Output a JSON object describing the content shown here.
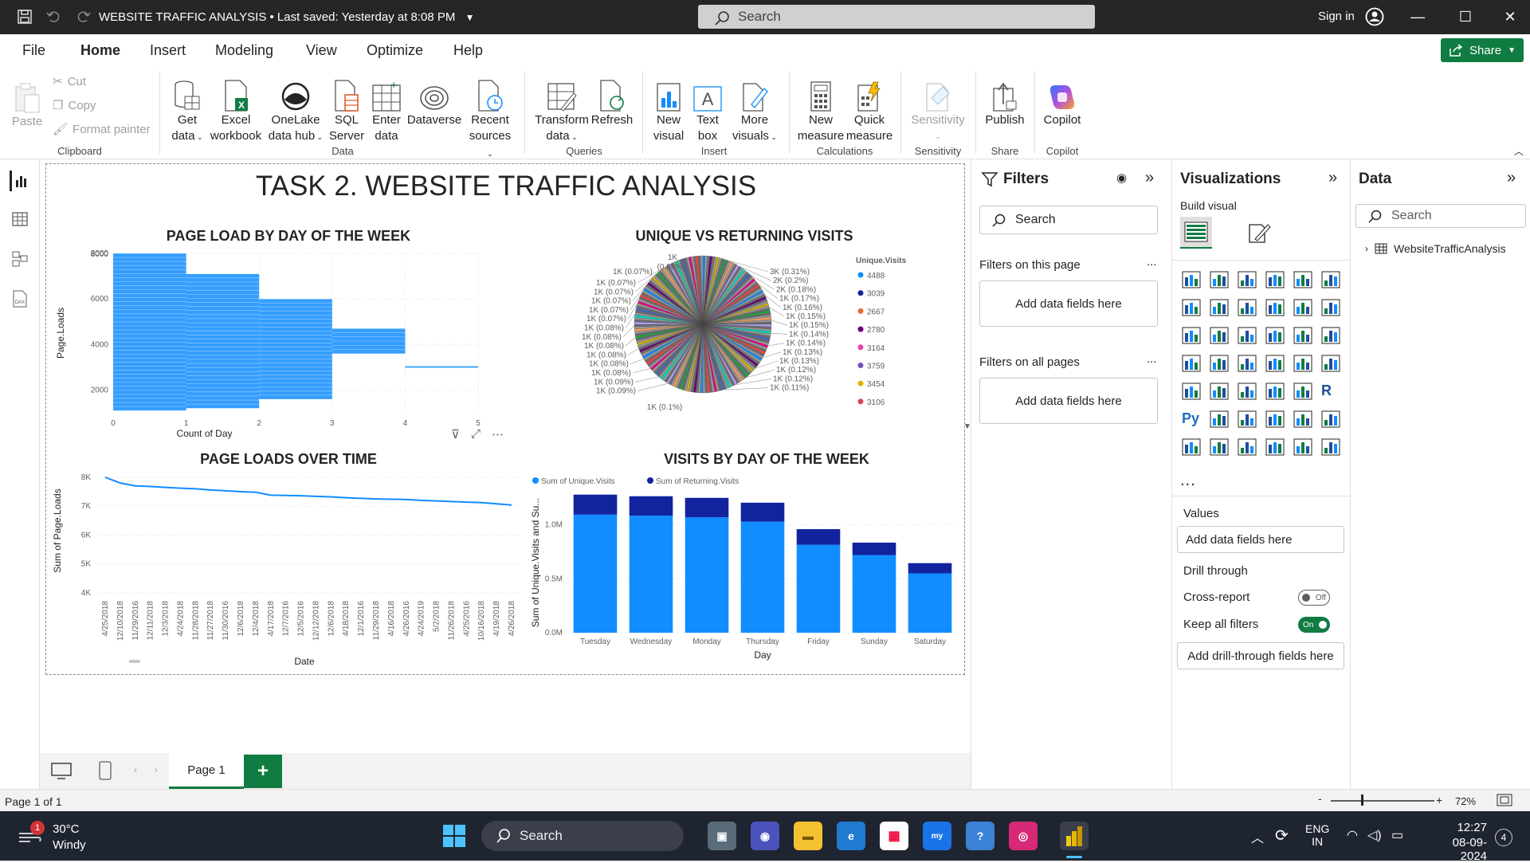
{
  "titlebar": {
    "title": "WEBSITE TRAFFIC ANALYSIS",
    "saved": "• Last saved: Yesterday at 8:08 PM",
    "search": "Search",
    "signin": "Sign in"
  },
  "menu": [
    "File",
    "Home",
    "Insert",
    "Modeling",
    "View",
    "Optimize",
    "Help"
  ],
  "share": "Share",
  "ribbon": {
    "clipboard": {
      "paste": "Paste",
      "cut": "Cut",
      "copy": "Copy",
      "format_painter": "Format painter",
      "group": "Clipboard"
    },
    "data": {
      "get_data": "Get",
      "get_data2": "data",
      "excel": "Excel",
      "excel2": "workbook",
      "onelake": "OneLake",
      "onelake2": "data hub",
      "sql": "SQL",
      "sql2": "Server",
      "enter": "Enter",
      "enter2": "data",
      "dataverse": "Dataverse",
      "recent": "Recent",
      "recent2": "sources",
      "group": "Data"
    },
    "queries": {
      "transform": "Transform",
      "transform2": "data",
      "refresh": "Refresh",
      "group": "Queries"
    },
    "insert": {
      "new_visual": "New",
      "new_visual2": "visual",
      "text_box": "Text",
      "text_box2": "box",
      "more": "More",
      "more2": "visuals",
      "group": "Insert"
    },
    "calculations": {
      "new_measure": "New",
      "new_measure2": "measure",
      "quick": "Quick",
      "quick2": "measure",
      "group": "Calculations"
    },
    "sensitivity": {
      "label": "Sensitivity",
      "group": "Sensitivity"
    },
    "share": {
      "publish": "Publish",
      "group": "Share"
    },
    "copilot": {
      "label": "Copilot",
      "group": "Copilot"
    }
  },
  "report": {
    "title": "TASK 2. WEBSITE TRAFFIC ANALYSIS"
  },
  "chart_data": [
    {
      "type": "bar",
      "title": "PAGE LOAD BY DAY OF THE WEEK",
      "xlabel": "Count of Day",
      "ylabel": "Page.Loads",
      "xlim": [
        0,
        5
      ],
      "xticks": [
        "0",
        "1",
        "2",
        "3",
        "4",
        "5"
      ],
      "ylim": [
        1000,
        8000
      ],
      "yticks": [
        "2000",
        "4000",
        "6000",
        "8000"
      ],
      "bands": [
        {
          "count": 1,
          "ymin": 1100,
          "ymax": 8000
        },
        {
          "count": 2,
          "ymin": 1200,
          "ymax": 7100
        },
        {
          "count": 3,
          "ymin": 1600,
          "ymax": 6000
        },
        {
          "count": 4,
          "ymin": 3600,
          "ymax": 4700
        },
        {
          "count": 5,
          "ymin": 3000,
          "ymax": 3050
        }
      ]
    },
    {
      "type": "pie",
      "title": "UNIQUE VS RETURNING VISITS",
      "legend_title": "Unique.Visits",
      "legend": [
        {
          "name": "4488",
          "color": "#118dff"
        },
        {
          "name": "3039",
          "color": "#12239e"
        },
        {
          "name": "2667",
          "color": "#e66c37"
        },
        {
          "name": "2780",
          "color": "#6b007b"
        },
        {
          "name": "3164",
          "color": "#e044a7"
        },
        {
          "name": "3759",
          "color": "#744ec2"
        },
        {
          "name": "3454",
          "color": "#d9b300"
        },
        {
          "name": "3106",
          "color": "#d64550"
        }
      ],
      "labels_right": [
        "3K (0.31%)",
        "2K (0.2%)",
        "2K (0.18%)",
        "1K (0.17%)",
        "1K (0.16%)",
        "1K (0.15%)",
        "1K (0.15%)",
        "1K (0.14%)",
        "1K (0.14%)",
        "1K (0.13%)",
        "1K (0.13%)",
        "1K (0.12%)",
        "1K (0.12%)",
        "1K (0.11%)"
      ],
      "labels_left": [
        "1K (0.07%)",
        "1K (0.07%)",
        "1K (0.07%)",
        "1K (0.07%)",
        "1K (0.07%)",
        "1K (0.08%)",
        "1K (0.08%)",
        "1K (0.08%)",
        "1K (0.08%)",
        "1K (0.08%)",
        "1K (0.08%)",
        "1K (0.09%)",
        "1K (0.09%)"
      ],
      "labels_top": [
        "1K",
        "(0.06%)",
        "1K (0.07%)"
      ],
      "labels_bottom": [
        "1K (0.1%)"
      ]
    },
    {
      "type": "line",
      "title": "PAGE LOADS OVER TIME",
      "xlabel": "Date",
      "ylabel": "Sum of Page.Loads",
      "ylim": [
        4000,
        8300
      ],
      "yticks": [
        "4K",
        "5K",
        "6K",
        "7K",
        "8K"
      ],
      "categories": [
        "4/25/2018",
        "12/10/2018",
        "11/29/2016",
        "12/11/2018",
        "12/3/2018",
        "4/24/2018",
        "11/28/2018",
        "11/27/2018",
        "11/30/2016",
        "12/6/2018",
        "12/4/2018",
        "4/17/2018",
        "12/7/2016",
        "12/5/2016",
        "12/12/2018",
        "12/6/2018",
        "4/18/2018",
        "12/1/2016",
        "11/29/2018",
        "4/16/2018",
        "4/26/2016",
        "4/24/2019",
        "5/2/2018",
        "11/26/2018",
        "4/25/2016",
        "10/16/2018",
        "4/19/2018",
        "4/26/2018"
      ],
      "values": [
        8000,
        7800,
        7700,
        7680,
        7650,
        7620,
        7600,
        7560,
        7530,
        7500,
        7480,
        7380,
        7370,
        7360,
        7340,
        7320,
        7290,
        7270,
        7250,
        7240,
        7230,
        7200,
        7180,
        7160,
        7140,
        7120,
        7080,
        7040
      ]
    },
    {
      "type": "bar",
      "title": "VISITS BY DAY OF THE WEEK",
      "xlabel": "Day",
      "ylabel": "Sum of Unique.Visits and Su...",
      "ylim": [
        0,
        1300000
      ],
      "yticks": [
        "0.0M",
        "0.5M",
        "1.0M"
      ],
      "categories": [
        "Tuesday",
        "Wednesday",
        "Monday",
        "Thursday",
        "Friday",
        "Sunday",
        "Saturday"
      ],
      "series": [
        {
          "name": "Sum of Unique.Visits",
          "color": "#118dff",
          "values": [
            1095000,
            1085000,
            1070000,
            1030000,
            815000,
            720000,
            550000
          ]
        },
        {
          "name": "Sum of Returning.Visits",
          "color": "#12239e",
          "values": [
            185000,
            180000,
            180000,
            175000,
            145000,
            115000,
            95000
          ]
        }
      ]
    }
  ],
  "filters": {
    "title": "Filters",
    "search": "Search",
    "this_page": "Filters on this page",
    "all_pages": "Filters on all pages",
    "add": "Add data fields here",
    "more": "..."
  },
  "visualizations": {
    "title": "Visualizations",
    "build": "Build visual",
    "values": "Values",
    "add": "Add data fields here",
    "drill": "Drill through",
    "cross": "Cross-report",
    "cross_state": "Off",
    "keep": "Keep all filters",
    "keep_state": "On",
    "add_drill": "Add drill-through fields here",
    "more": "...",
    "r": "R",
    "py": "Py"
  },
  "data_pane": {
    "title": "Data",
    "search": "Search",
    "table": "WebsiteTrafficAnalysis"
  },
  "pages": {
    "tab": "Page 1",
    "add": "+"
  },
  "status": {
    "page": "Page 1 of 1",
    "zoom": "72%",
    "minus": "-",
    "plus": "+"
  },
  "taskbar": {
    "temp": "30°C",
    "weather": "Windy",
    "badge": "1",
    "search": "Search",
    "lang1": "ENG",
    "lang2": "IN",
    "time": "12:27",
    "date": "08-09-2024",
    "notif": "4"
  }
}
